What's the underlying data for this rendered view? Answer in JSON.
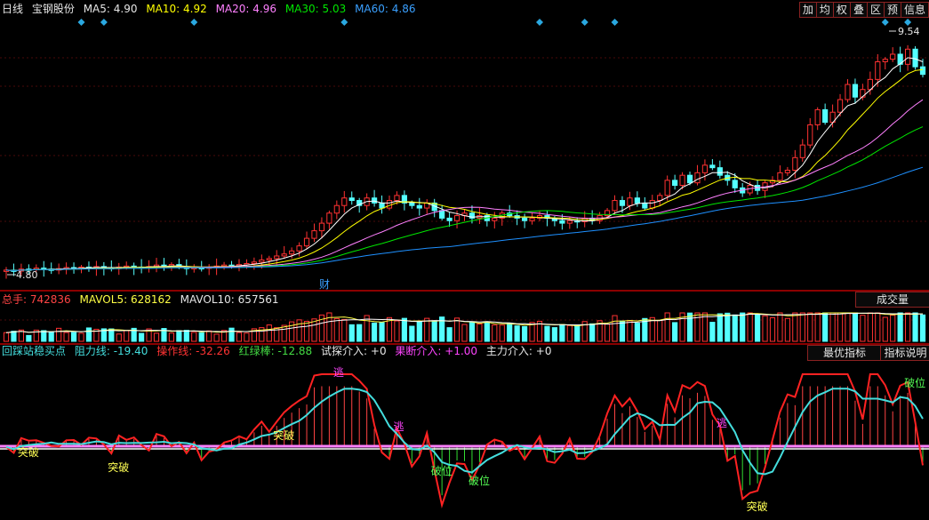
{
  "header": {
    "period": "日线",
    "stock_name": "宝钢股份",
    "ma5_label": "MA5:",
    "ma5_value": "4.90",
    "ma10_label": "MA10:",
    "ma10_value": "4.92",
    "ma20_label": "MA20:",
    "ma20_value": "4.96",
    "ma30_label": "MA30:",
    "ma30_value": "5.03",
    "ma60_label": "MA60:",
    "ma60_value": "4.86"
  },
  "toolbar": [
    "加",
    "均",
    "权",
    "叠",
    "区",
    "预",
    "信息"
  ],
  "price_pane": {
    "high_label": "9.54",
    "low_label": "4.80",
    "event_label": "财"
  },
  "volume_pane": {
    "total_label": "总手:",
    "total_value": "742836",
    "mavol5_label": "MAVOL5:",
    "mavol5_value": "628162",
    "mavol10_label": "MAVOL10:",
    "mavol10_value": "657561",
    "selector": "成交量"
  },
  "indicator_pane": {
    "name": "回踩站稳买点",
    "resist_label": "阻力线:",
    "resist_value": "-19.40",
    "op_label": "操作线:",
    "op_value": "-32.26",
    "redgreen_label": "红绿棒:",
    "redgreen_value": "-12.88",
    "trial_label": "试探介入:",
    "trial_value": "+0",
    "decisive_label": "果断介入:",
    "decisive_value": "+1.00",
    "main_label": "主力介入:",
    "main_value": "+0",
    "best_button": "最优指标",
    "help_button": "指标说明",
    "signals": {
      "breakthrough": "突破",
      "escape": "逃",
      "break_level": "破位"
    }
  },
  "colors": {
    "up": "#ff3232",
    "down": "#54ffff",
    "ma5": "#ffffff",
    "ma10": "#ffff00",
    "ma20": "#ff80ff",
    "ma30": "#00e600",
    "ma60": "#1e90ff",
    "op_line": "#ff2222",
    "resist_line": "#44dddd",
    "zero_line": "#ff80ff",
    "marker": "#2aa8e0"
  },
  "chart_data": {
    "type": "candlestick",
    "closes": [
      4.82,
      4.8,
      4.84,
      4.83,
      4.86,
      4.84,
      4.82,
      4.85,
      4.87,
      4.86,
      4.88,
      4.86,
      4.89,
      4.87,
      4.85,
      4.88,
      4.9,
      4.88,
      4.86,
      4.89,
      4.92,
      4.9,
      4.93,
      4.88,
      4.85,
      4.87,
      4.86,
      4.88,
      4.9,
      4.92,
      4.9,
      4.93,
      4.95,
      4.98,
      5.02,
      5.05,
      5.1,
      5.14,
      5.2,
      5.3,
      5.45,
      5.6,
      5.75,
      5.95,
      6.1,
      6.25,
      6.2,
      6.1,
      6.25,
      6.15,
      6.05,
      6.2,
      6.3,
      6.15,
      6.1,
      6.05,
      6.15,
      6.0,
      5.85,
      5.8,
      5.9,
      5.95,
      5.85,
      5.9,
      5.8,
      5.85,
      5.95,
      5.9,
      5.85,
      5.8,
      5.85,
      5.9,
      5.85,
      5.8,
      5.75,
      5.8,
      5.78,
      5.85,
      5.8,
      5.9,
      6.0,
      6.2,
      6.1,
      6.25,
      6.15,
      6.05,
      6.2,
      6.3,
      6.6,
      6.5,
      6.7,
      6.55,
      6.75,
      6.9,
      6.85,
      6.7,
      6.6,
      6.45,
      6.35,
      6.5,
      6.4,
      6.55,
      6.6,
      6.75,
      6.8,
      7.05,
      7.3,
      7.7,
      8.0,
      7.75,
      7.95,
      8.2,
      8.5,
      8.25,
      8.4,
      8.6,
      8.95,
      9.0,
      9.1,
      8.9,
      9.2,
      8.85,
      8.7
    ],
    "price_high": 9.54,
    "price_low": 4.8,
    "ma_last": {
      "MA5": 4.9,
      "MA10": 4.92,
      "MA20": 4.96,
      "MA30": 5.03,
      "MA60": 4.86
    },
    "volume_last": {
      "total": 742836,
      "MAVOL5": 628162,
      "MAVOL10": 657561
    },
    "indicator_last": {
      "resist": -19.4,
      "operation": -32.26,
      "red_green": -12.88,
      "trial": 0,
      "decisive": 1.0,
      "main": 0
    }
  }
}
